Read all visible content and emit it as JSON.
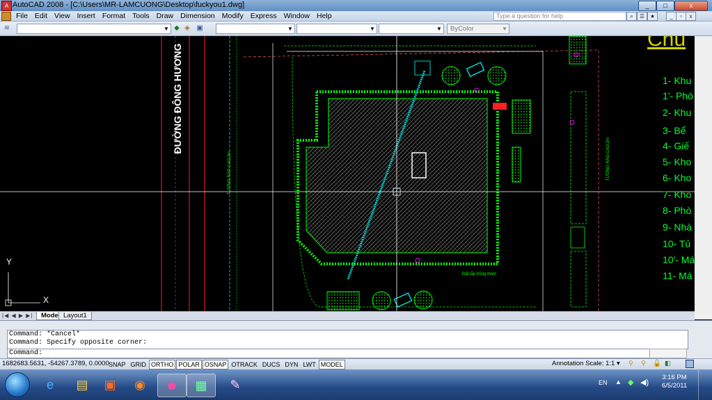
{
  "window": {
    "title": "AutoCAD 2008 - [C:\\Users\\MR-LAMCUONG\\Desktop\\fuckyou1.dwg]",
    "controls": [
      "_",
      "□",
      "x"
    ]
  },
  "menubar": {
    "items": [
      "File",
      "Edit",
      "View",
      "Insert",
      "Format",
      "Tools",
      "Draw",
      "Dimension",
      "Modify",
      "Express",
      "Window",
      "Help"
    ],
    "help_placeholder": "Type a question for help"
  },
  "toolbar": {
    "color_combo_value": "ByColor"
  },
  "drawing": {
    "street_label": "ĐƯỜNG ĐÔNG HƯƠNG",
    "wall_label_left": "TƯỜNG RÀO CAO 2m",
    "wall_label_right": "TƯỜNG RÀO CAO 2m",
    "area_label": "Đất lắp trồng thảm",
    "heading": "Chú",
    "legend_items": [
      "1- Khu",
      "1'- Phò",
      "2- Khu",
      "3- Bể",
      "4- Giế",
      "5- Kho",
      "6- Kho",
      "7- Kho",
      "8- Phò",
      "9- Nhà",
      "10- Tủ",
      "10'- Má",
      "11- Má"
    ],
    "ucs_x": "X",
    "ucs_y": "Y",
    "colors": {
      "line_green": "#00ff00",
      "cyan": "#00ffff",
      "red": "#ff2020",
      "magenta": "#ff00ff",
      "crosshair": "#ffffff"
    }
  },
  "layout_tabs": [
    "Model",
    "Layout1"
  ],
  "command": {
    "lines": [
      "Command: *Cancel*",
      "Command: Specify opposite corner:"
    ],
    "prompt": "Command:"
  },
  "statusbar": {
    "coordinates": "1682683.5631, -54267.3789, 0.0000",
    "buttons": [
      {
        "label": "SNAP",
        "on": false
      },
      {
        "label": "GRID",
        "on": false
      },
      {
        "label": "ORTHO",
        "on": true
      },
      {
        "label": "POLAR",
        "on": true
      },
      {
        "label": "OSNAP",
        "on": true
      },
      {
        "label": "OTRACK",
        "on": false
      },
      {
        "label": "DUCS",
        "on": false
      },
      {
        "label": "DYN",
        "on": false
      },
      {
        "label": "LWT",
        "on": false
      },
      {
        "label": "MODEL",
        "on": true
      }
    ],
    "annotation_scale_label": "Annotation Scale:",
    "annotation_scale_value": "1:1"
  },
  "taskbar": {
    "language": "EN",
    "time": "3:16 PM",
    "date": "6/5/2011"
  }
}
